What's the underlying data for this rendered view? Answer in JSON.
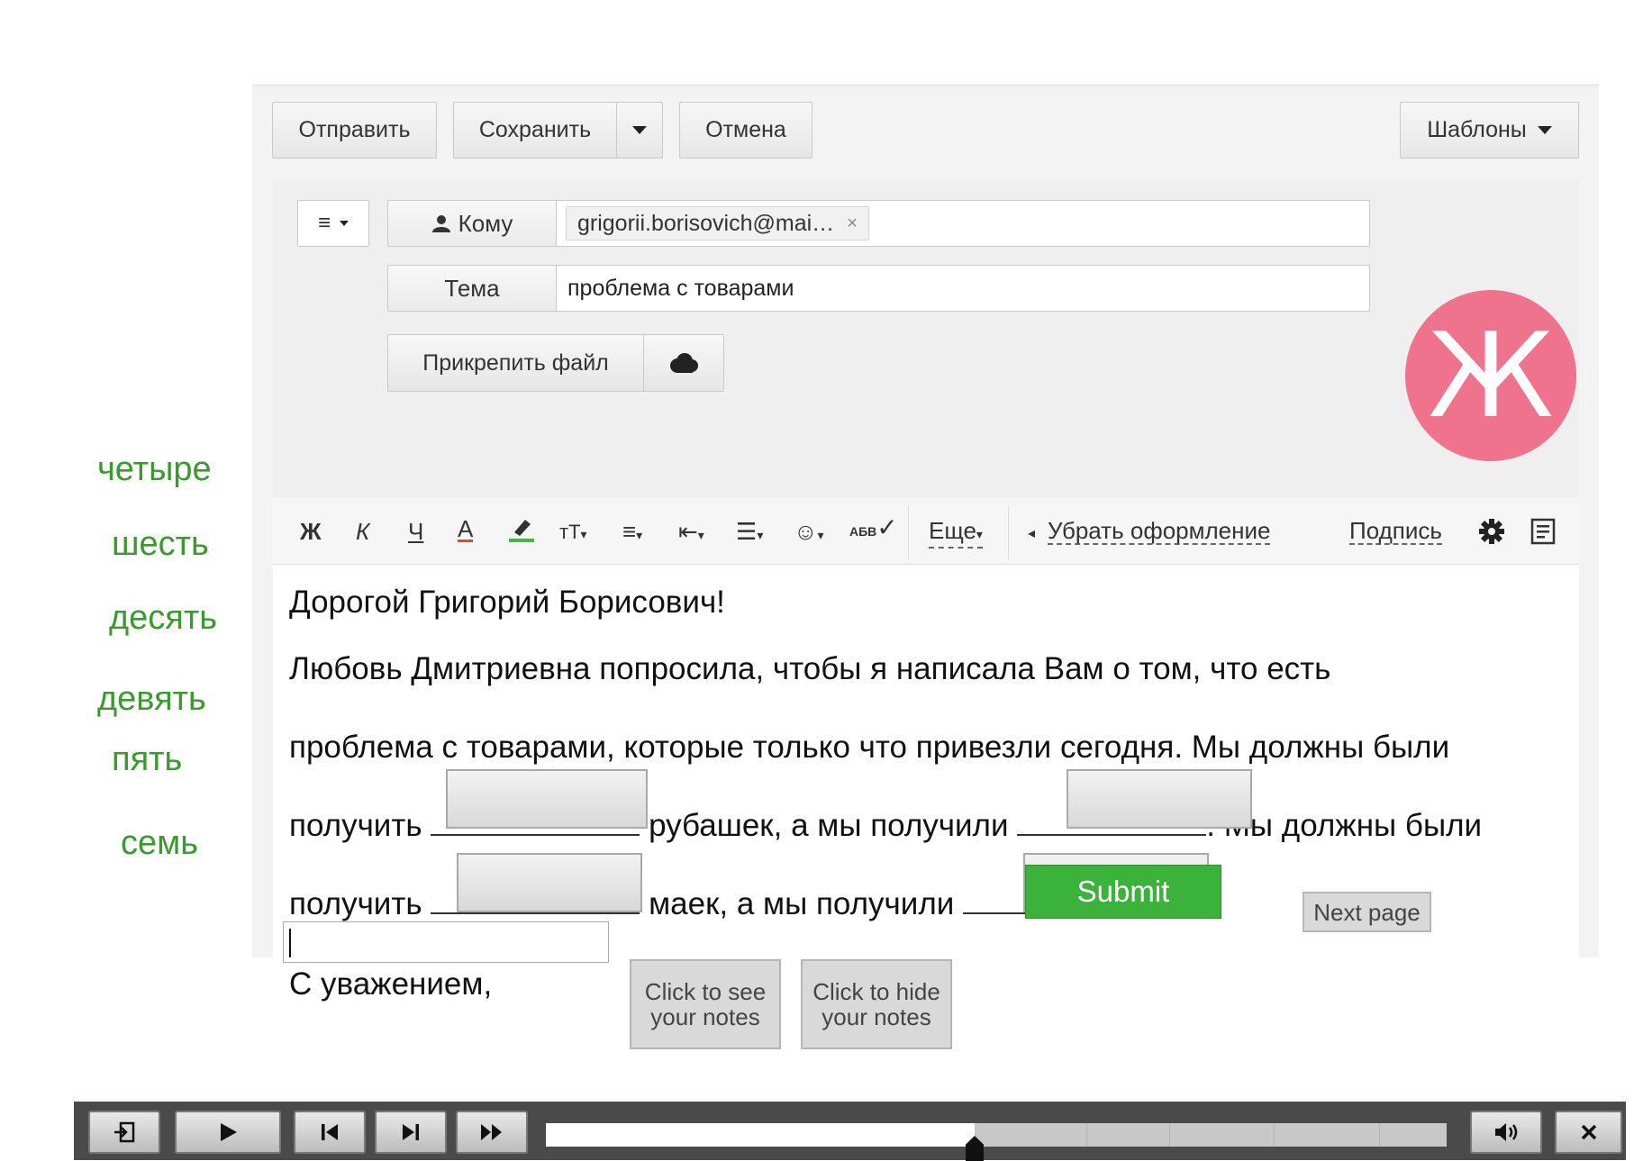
{
  "toolbar": {
    "send_label": "Отправить",
    "save_label": "Сохранить",
    "cancel_label": "Отмена",
    "templates_label": "Шаблоны"
  },
  "compose": {
    "to_label": "Кому",
    "to_recipient": "grigorii.borisovich@mai…",
    "subject_label": "Тема",
    "subject_value": "проблема с товарами",
    "attach_label": "Прикрепить файл",
    "avatar_letter": "Ж",
    "avatar_color": "#f0738e"
  },
  "format_bar": {
    "bold": "Ж",
    "italic": "К",
    "underline": "Ч",
    "font_color": "А",
    "text_size": "тТ",
    "spellcheck": "АБВ",
    "more_label": "Еще",
    "clear_format_label": "Убрать оформление",
    "signature_label": "Подпись"
  },
  "letter": {
    "greeting": "Дорогой Григорий Борисович!",
    "line1": "Любовь Дмитриевна попросила, чтобы я написала Вам о том, что есть",
    "line2": "проблема с товарами, которые только что привезли сегодня. Мы должны были",
    "line3_a": "получить",
    "line3_b": "рубашек, а мы получили",
    "line3_c": ". Мы должны были",
    "line4_a": "получить",
    "line4_b": "маек, а мы получили",
    "line4_c": ".",
    "closing": "С уважением,"
  },
  "word_bank": [
    "четыре",
    "шесть",
    "десять",
    "девять",
    "пять",
    "семь"
  ],
  "word_color": "#3a9a2e",
  "actions": {
    "submit_label": "Submit",
    "next_page_label": "Next page",
    "see_notes_label": "Click to see your notes",
    "hide_notes_label": "Click to hide your notes",
    "submit_color": "#3bb33a"
  },
  "player": {
    "progress_fraction": 0.476
  }
}
